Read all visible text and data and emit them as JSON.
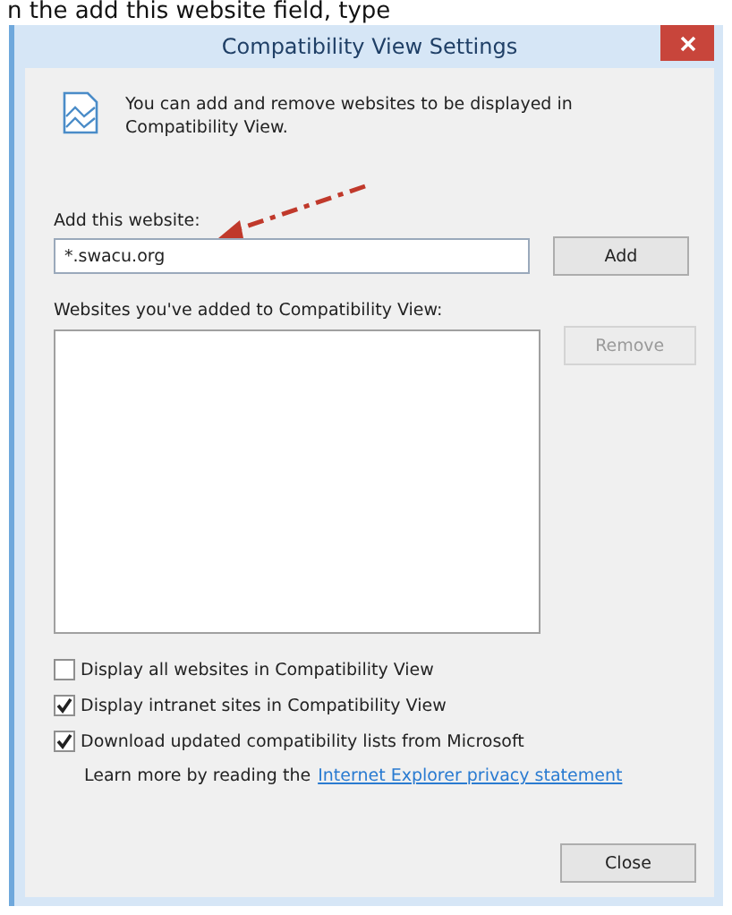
{
  "caption": "n the add this website field, type",
  "window": {
    "title": "Compatibility View Settings"
  },
  "intro": "You can add and remove websites to be displayed in Compatibility View.",
  "add_field": {
    "label": "Add this website:",
    "value": "*.swacu.org"
  },
  "add_button": {
    "label": "Add",
    "disabled": false
  },
  "list": {
    "label": "Websites you've added to Compatibility View:"
  },
  "remove_button": {
    "label": "Remove",
    "disabled": true
  },
  "options": [
    {
      "label": "Display all websites in Compatibility View",
      "checked": false
    },
    {
      "label": "Display intranet sites in Compatibility View",
      "checked": true
    },
    {
      "label": "Download updated compatibility lists from Microsoft",
      "checked": true
    }
  ],
  "learn_more": {
    "text": "Learn more by reading the",
    "link": "Internet Explorer privacy statement"
  },
  "close_button": {
    "label": "Close",
    "disabled": false
  }
}
